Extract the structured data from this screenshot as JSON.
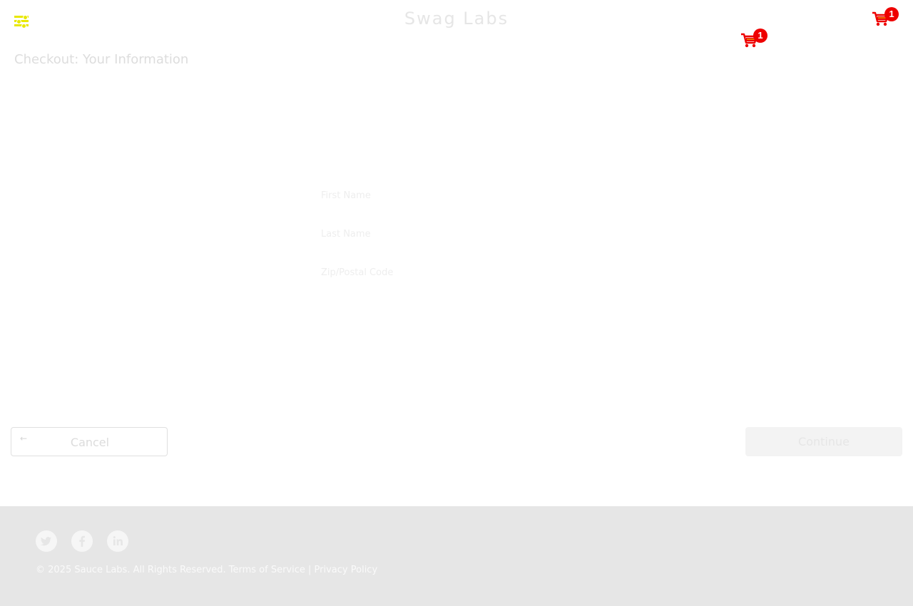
{
  "header": {
    "logo_text": "Swag Labs",
    "menu_icon": "hamburger-menu-icon",
    "carts": [
      {
        "icon": "shopping-cart-icon",
        "badge_count": "1"
      },
      {
        "icon": "shopping-cart-icon",
        "badge_count": "1"
      }
    ]
  },
  "page": {
    "title": "Checkout: Your Information"
  },
  "form": {
    "first_name_placeholder": "First Name",
    "last_name_placeholder": "Last Name",
    "postal_code_placeholder": "Zip/Postal Code"
  },
  "actions": {
    "cancel_label": "Cancel",
    "cancel_icon": "arrow-left-icon",
    "continue_label": "Continue"
  },
  "footer": {
    "social_icons": [
      "twitter-icon",
      "facebook-icon",
      "linkedin-icon"
    ],
    "copyright": "© 2025 Sauce Labs. All Rights Reserved.",
    "terms_link": "Terms of Service",
    "separator": "|",
    "privacy_link": "Privacy Policy"
  },
  "colors": {
    "badge": "#ee0000",
    "cart_icon": "#ee0000",
    "cart_icon_accent": "#e8e800",
    "menu_icon": "#e8e800",
    "footer_bg": "#e6e6e6"
  }
}
